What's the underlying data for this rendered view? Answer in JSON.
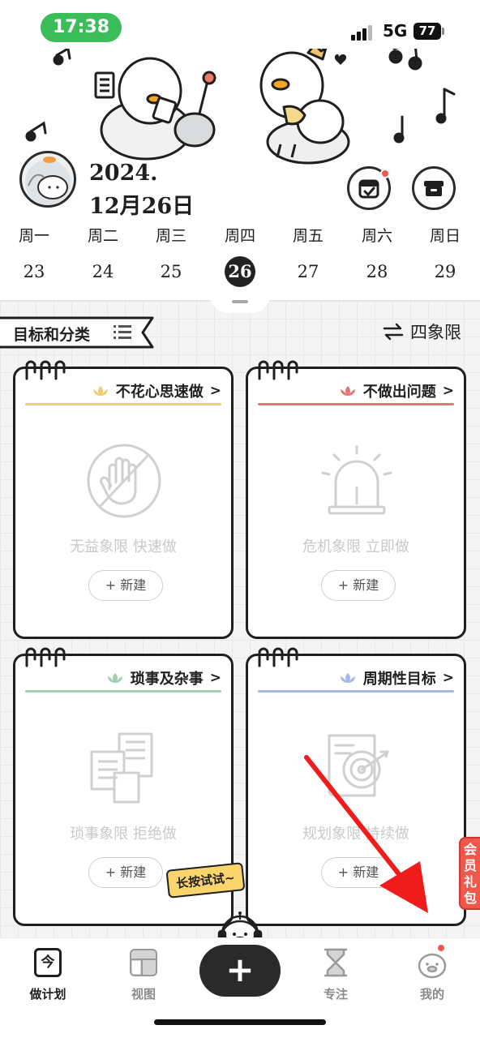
{
  "status_bar": {
    "time": "17:38",
    "network": "5G",
    "battery": "77"
  },
  "header": {
    "date_line1": "2024.",
    "date_line2": "12月26日",
    "calendar_button_icon": "calendar-check-icon",
    "archive_button_icon": "archive-box-icon"
  },
  "week": [
    {
      "name": "周一",
      "num": "23"
    },
    {
      "name": "周二",
      "num": "24"
    },
    {
      "name": "周三",
      "num": "25"
    },
    {
      "name": "周四",
      "num": "26",
      "active": true
    },
    {
      "name": "周五",
      "num": "27"
    },
    {
      "name": "周六",
      "num": "28"
    },
    {
      "name": "周日",
      "num": "29"
    }
  ],
  "section": {
    "title": "目标和分类",
    "mode_label": "四象限"
  },
  "quadrants": [
    {
      "title": "不花心思速做",
      "description": "无益象限 快速做",
      "button": "+ 新建",
      "color": "#f0cd6e",
      "icon": "hand-stop-icon"
    },
    {
      "title": "不做出问题",
      "description": "危机象限 立即做",
      "button": "+ 新建",
      "color": "#e57575",
      "icon": "alarm-siren-icon"
    },
    {
      "title": "琐事及杂事",
      "description": "琐事象限 拒绝做",
      "button": "+ 新建",
      "color": "#9fcfae",
      "icon": "documents-icon"
    },
    {
      "title": "周期性目标",
      "description": "规划象限 持续做",
      "button": "+ 新建",
      "color": "#a7b6e8",
      "icon": "target-scroll-icon"
    }
  ],
  "floating": {
    "tooltip": "长按试试~",
    "gift_tab": "会员礼包"
  },
  "nav": {
    "items": [
      {
        "label": "做计划",
        "icon": "today-calendar-icon",
        "active": true
      },
      {
        "label": "视图",
        "icon": "layout-view-icon"
      },
      {
        "label": "专注",
        "icon": "hourglass-icon"
      },
      {
        "label": "我的",
        "icon": "profile-duck-icon"
      }
    ],
    "fab_label": "+",
    "today_glyph": "今"
  }
}
